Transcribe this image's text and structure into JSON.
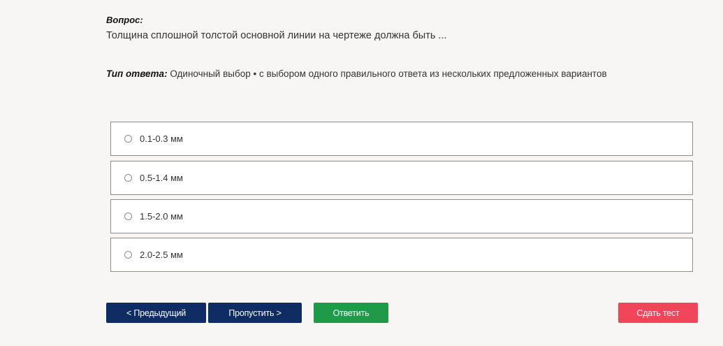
{
  "question": {
    "label": "Вопрос:",
    "text": "Толщина сплошной толстой основной линии на чертеже должна быть ..."
  },
  "answer_type": {
    "label": "Тип ответа:",
    "value": "Одиночный выбор • с выбором одного правильного ответа из нескольких предложенных вариантов"
  },
  "options": [
    {
      "label": "0.1-0.3 мм",
      "selected": false
    },
    {
      "label": "0.5-1.4 мм",
      "selected": false
    },
    {
      "label": "1.5-2.0 мм",
      "selected": false
    },
    {
      "label": "2.0-2.5 мм",
      "selected": false
    }
  ],
  "buttons": {
    "prev": "< Предыдущий",
    "skip": "Пропустить >",
    "answer": "Ответить",
    "submit": "Сдать тест"
  },
  "colors": {
    "nav_button": "#0f2c63",
    "answer_button": "#1f9a48",
    "submit_button": "#f1465a",
    "background": "#f7f6f5"
  }
}
